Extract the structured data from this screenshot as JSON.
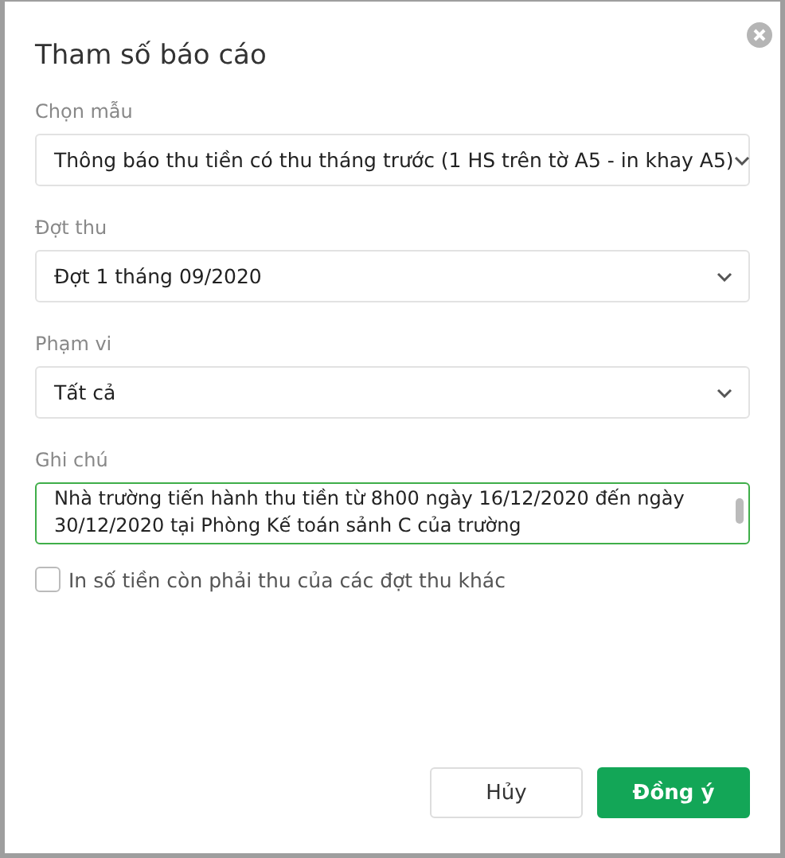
{
  "dialog": {
    "title": "Tham số báo cáo",
    "fields": [
      {
        "kind": "select",
        "label": "Chọn mẫu",
        "value": "Thông báo thu tiền có thu tháng trước (1 HS trên tờ A5 - in khay A5)"
      },
      {
        "kind": "select",
        "label": "Đợt thu",
        "value": "Đợt 1 tháng 09/2020"
      },
      {
        "kind": "select",
        "label": "Phạm vi",
        "value": "Tất cả"
      },
      {
        "kind": "textarea",
        "label": "Ghi chú",
        "value": "Nhà trường tiến hành thu tiền từ 8h00 ngày 16/12/2020 đến ngày 30/12/2020 tại Phòng Kế toán sảnh C của trường"
      }
    ],
    "checkbox": {
      "label": "In số tiền còn phải thu của các đợt thu khác",
      "checked": false
    },
    "buttons": [
      {
        "kind": "secondary",
        "label": "Hủy"
      },
      {
        "kind": "primary",
        "label": "Đồng ý"
      }
    ]
  }
}
